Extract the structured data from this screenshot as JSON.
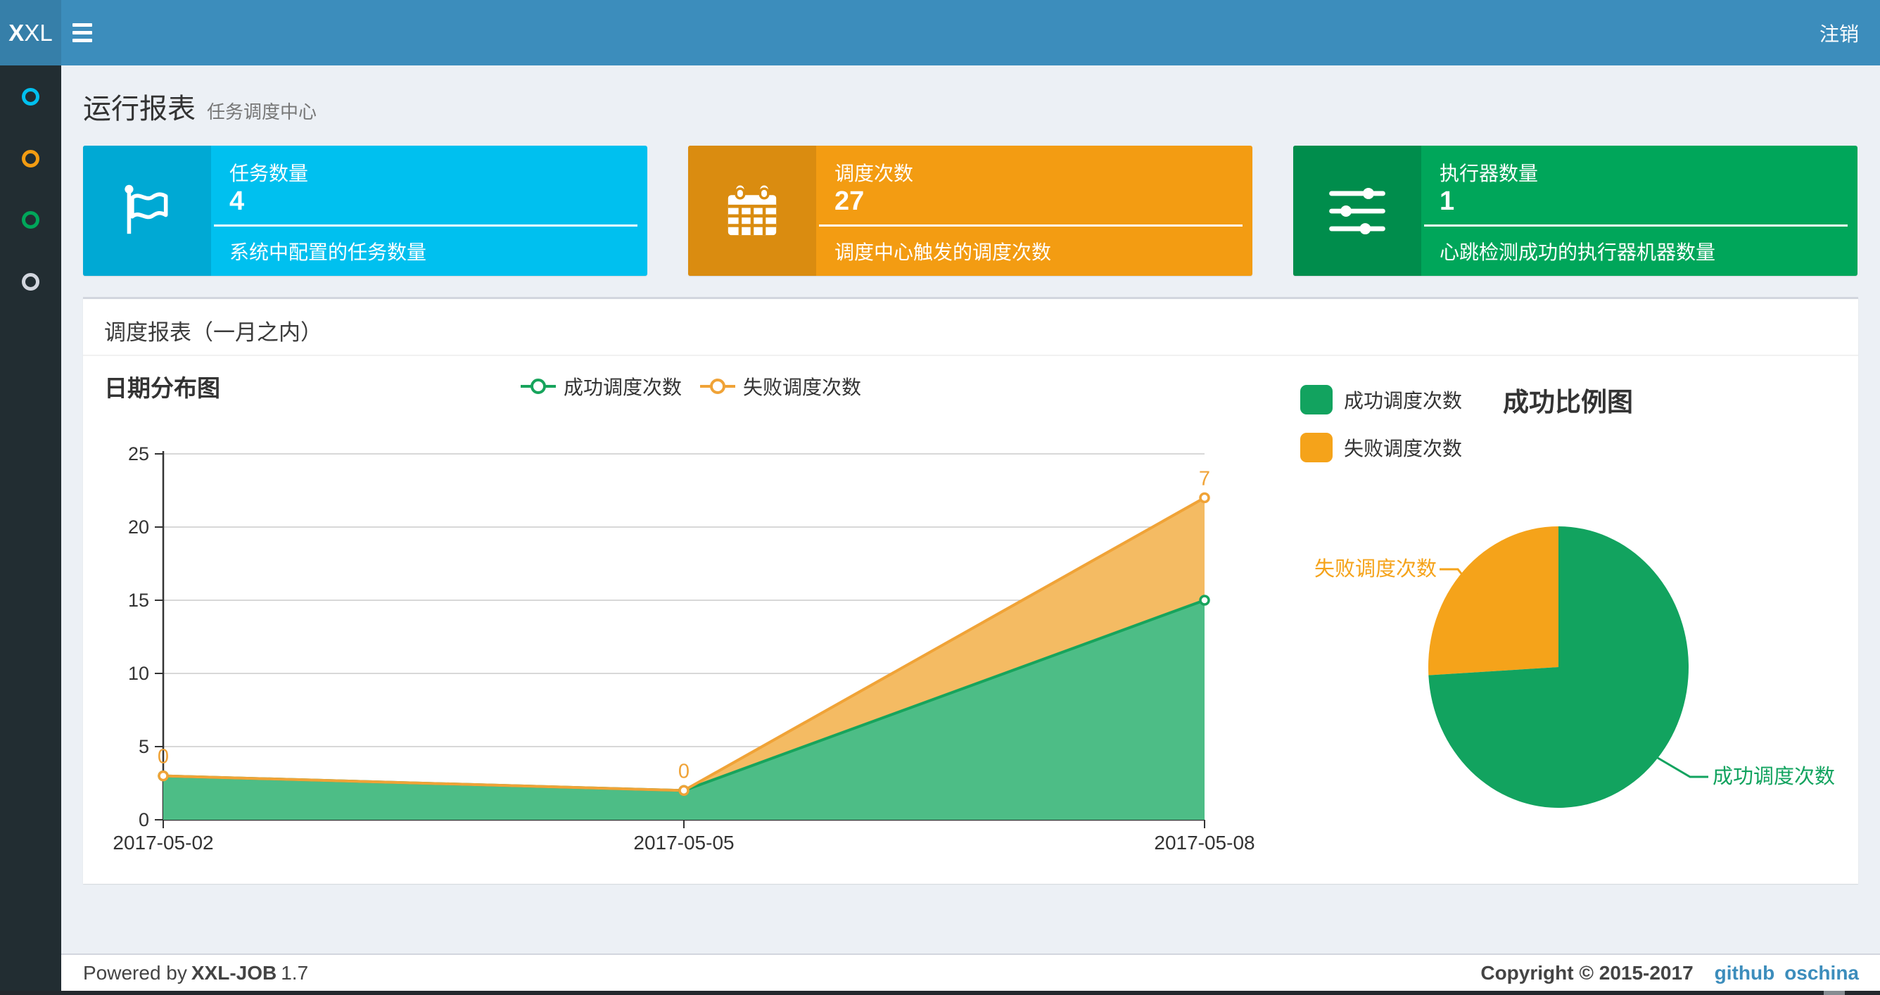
{
  "navbar": {
    "logo_bold": "X",
    "logo_rest": "XL",
    "logout": "注销"
  },
  "sidebar": {
    "items": [
      {
        "name": "menu-item-1",
        "icon": "circle-outline-icon",
        "color": "#00c0ef"
      },
      {
        "name": "menu-item-2",
        "icon": "circle-outline-icon",
        "color": "#f39c12"
      },
      {
        "name": "menu-item-3",
        "icon": "circle-outline-icon",
        "color": "#00a65a"
      },
      {
        "name": "menu-item-4",
        "icon": "circle-outline-icon",
        "color": "#d2d6de"
      }
    ]
  },
  "page_header": {
    "title": "运行报表",
    "subtitle": "任务调度中心"
  },
  "cards": [
    {
      "label": "任务数量",
      "value": "4",
      "desc": "系统中配置的任务数量",
      "color": "#00c0ef",
      "icon_bg": "#00a9d4",
      "icon": "flag-icon"
    },
    {
      "label": "调度次数",
      "value": "27",
      "desc": "调度中心触发的调度次数",
      "color": "#f39c12",
      "icon_bg": "#da8c10",
      "icon": "calendar-icon"
    },
    {
      "label": "执行器数量",
      "value": "1",
      "desc": "心跳检测成功的执行器机器数量",
      "color": "#00a65a",
      "icon_bg": "#008d4c",
      "icon": "sliders-icon"
    }
  ],
  "panel": {
    "title": "调度报表（一月之内）"
  },
  "line_chart": {
    "title": "日期分布图",
    "legend": [
      "成功调度次数",
      "失败调度次数"
    ]
  },
  "pie_chart": {
    "title": "成功比例图",
    "legend": [
      "成功调度次数",
      "失败调度次数"
    ],
    "labels": {
      "success": "成功调度次数",
      "fail": "失败调度次数"
    }
  },
  "footer": {
    "powered_prefix": "Powered by",
    "brand": "XXL-JOB",
    "version": "1.7",
    "copyright": "Copyright © 2015-2017",
    "links": [
      "github",
      "oschina"
    ]
  },
  "chart_data": [
    {
      "type": "area",
      "title": "日期分布图",
      "x": [
        "2017-05-02",
        "2017-05-05",
        "2017-05-08"
      ],
      "series": [
        {
          "name": "成功调度次数",
          "values": [
            3,
            2,
            15
          ],
          "color": "#17a45c",
          "fill": "#4dbd86"
        },
        {
          "name": "失败调度次数",
          "values": [
            0,
            0,
            7
          ],
          "color": "#f0a337",
          "fill": "#f4bb63"
        }
      ],
      "stacked": true,
      "ylim": [
        0,
        25
      ],
      "yticks": [
        0,
        5,
        10,
        15,
        20,
        25
      ],
      "data_labels": {
        "series": "失败调度次数",
        "values": [
          0,
          0,
          7
        ]
      },
      "legend_position": "top",
      "grid": true
    },
    {
      "type": "pie",
      "title": "成功比例图",
      "slices": [
        {
          "name": "成功调度次数",
          "value": 20,
          "color": "#12a35f"
        },
        {
          "name": "失败调度次数",
          "value": 7,
          "color": "#f5a31a"
        }
      ],
      "start_angle_deg": 90,
      "direction": "clockwise"
    }
  ]
}
